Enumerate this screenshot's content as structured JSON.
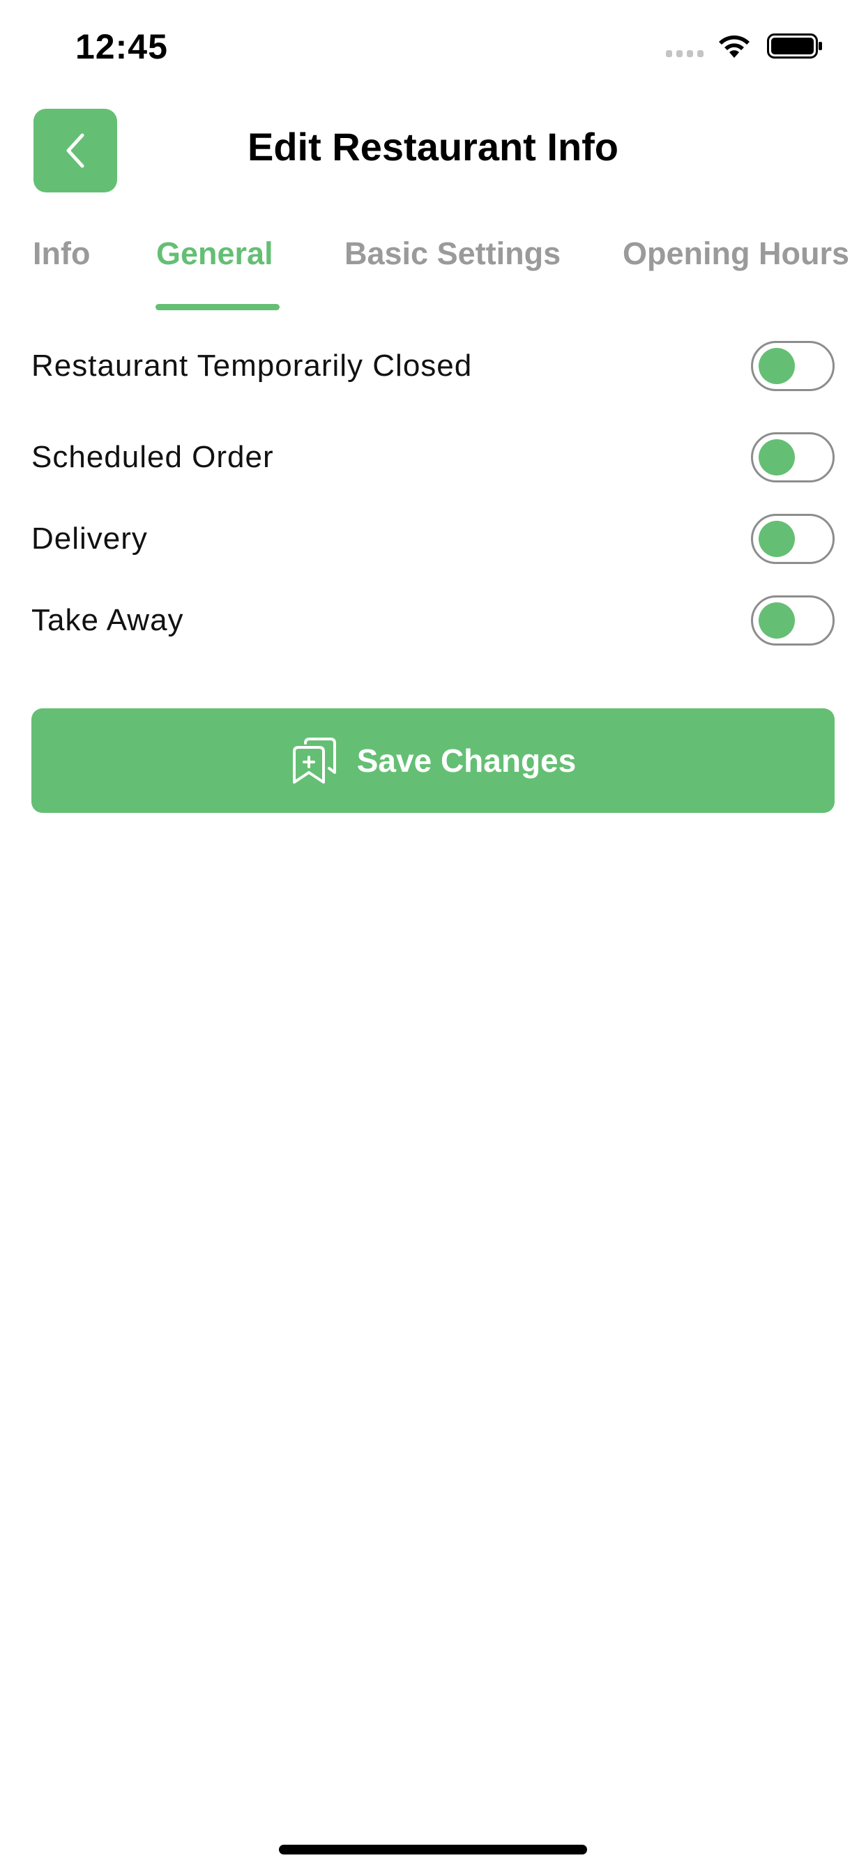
{
  "status_bar": {
    "time": "12:45",
    "icons": [
      "signal-icon",
      "wifi-icon",
      "battery-icon"
    ]
  },
  "header": {
    "title": "Edit Restaurant Info",
    "back_icon": "chevron-left-icon"
  },
  "tabs": [
    {
      "label": "Info",
      "active": false
    },
    {
      "label": "General",
      "active": true
    },
    {
      "label": "Basic Settings",
      "active": false
    },
    {
      "label": "Opening Hours",
      "active": false
    }
  ],
  "settings": [
    {
      "label": "Restaurant Temporarily Closed",
      "state": "off"
    },
    {
      "label": "Scheduled Order",
      "state": "off"
    },
    {
      "label": "Delivery",
      "state": "off"
    },
    {
      "label": "Take Away",
      "state": "off"
    }
  ],
  "save_button": {
    "label": "Save Changes",
    "icon": "bookmark-add-icon"
  },
  "colors": {
    "accent": "#64bf74",
    "inactive_tab": "#9a9a9a",
    "text": "#111111",
    "toggle_border": "#8d8d8d"
  }
}
